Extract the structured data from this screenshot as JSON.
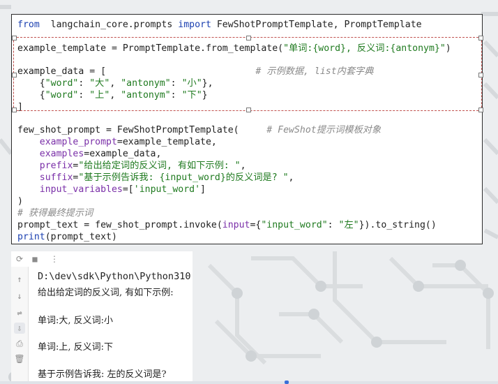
{
  "editor": {
    "lines": [
      {
        "parts": [
          [
            "kw",
            "from"
          ],
          [
            "",
            "  langchain_core.prompts "
          ],
          [
            "kw",
            "import"
          ],
          [
            "",
            " FewShotPromptTemplate, PromptTemplate"
          ]
        ]
      },
      {
        "parts": [
          [
            "",
            "example_template = PromptTemplate.from_template("
          ],
          [
            "str",
            "\"单词:{word}, 反义词:{antonym}\""
          ],
          [
            "",
            ")"
          ]
        ]
      },
      {
        "parts": [
          [
            "",
            "example_data = [                           "
          ],
          [
            "cm",
            "# 示例数据, list内套字典"
          ]
        ]
      },
      {
        "parts": [
          [
            "",
            "    {"
          ],
          [
            "str",
            "\"word\""
          ],
          [
            "",
            ": "
          ],
          [
            "str",
            "\"大\""
          ],
          [
            "",
            ", "
          ],
          [
            "str",
            "\"antonym\""
          ],
          [
            "",
            ": "
          ],
          [
            "str",
            "\"小\""
          ],
          [
            "",
            "},"
          ]
        ]
      },
      {
        "parts": [
          [
            "",
            "    {"
          ],
          [
            "str",
            "\"word\""
          ],
          [
            "",
            ": "
          ],
          [
            "str",
            "\"上\""
          ],
          [
            "",
            ", "
          ],
          [
            "str",
            "\"antonym\""
          ],
          [
            "",
            ": "
          ],
          [
            "str",
            "\"下\""
          ],
          [
            "",
            "}"
          ]
        ]
      },
      {
        "parts": [
          [
            "",
            "]"
          ]
        ]
      },
      {
        "parts": [
          [
            "",
            "few_shot_prompt = FewShotPromptTemplate(     "
          ],
          [
            "cm",
            "# FewShot提示词模板对象"
          ]
        ]
      },
      {
        "parts": [
          [
            "arg",
            "    example_prompt"
          ],
          [
            "",
            "=example_template,"
          ]
        ]
      },
      {
        "parts": [
          [
            "arg",
            "    examples"
          ],
          [
            "",
            "=example_data,"
          ]
        ]
      },
      {
        "parts": [
          [
            "arg",
            "    prefix"
          ],
          [
            "",
            "="
          ],
          [
            "str",
            "\"给出给定词的反义词, 有如下示例: \""
          ],
          [
            "",
            ","
          ]
        ]
      },
      {
        "parts": [
          [
            "arg",
            "    suffix"
          ],
          [
            "",
            "="
          ],
          [
            "str",
            "\"基于示例告诉我: {input_word}的反义词是? \""
          ],
          [
            "",
            ","
          ]
        ]
      },
      {
        "parts": [
          [
            "arg",
            "    input_variables"
          ],
          [
            "",
            "=["
          ],
          [
            "str",
            "'input_word'"
          ],
          [
            "",
            "]"
          ]
        ]
      },
      {
        "parts": [
          [
            "",
            ")"
          ]
        ]
      },
      {
        "parts": [
          [
            "cm",
            "# 获得最终提示词"
          ]
        ]
      },
      {
        "parts": [
          [
            "",
            "prompt_text = few_shot_prompt.invoke("
          ],
          [
            "arg",
            "input"
          ],
          [
            "",
            "={"
          ],
          [
            "str",
            "\"input_word\""
          ],
          [
            "",
            ": "
          ],
          [
            "str",
            "\"左\""
          ],
          [
            "",
            "}).to_string()"
          ]
        ]
      },
      {
        "parts": [
          [
            "kw",
            "print"
          ],
          [
            "",
            "(prompt_text)"
          ]
        ]
      }
    ]
  },
  "run_panel": {
    "toolbar_icons": [
      "rerun-icon",
      "stop-icon",
      "more-icon"
    ],
    "toolbar_glyphs": [
      "⟳",
      "■",
      "⋮"
    ],
    "gutter_icons": [
      "up-arrow-icon",
      "down-arrow-icon",
      "soft-wrap-icon",
      "scroll-to-end-icon",
      "print-icon",
      "trash-icon"
    ],
    "gutter_glyphs": [
      "↑",
      "↓",
      "⇌",
      "⇩",
      "⎙",
      "🗑"
    ],
    "output": {
      "path": "D:\\dev\\sdk\\Python\\Python310",
      "prefix": "给出给定词的反义词, 有如下示例:",
      "example1": "单词:大, 反义词:小",
      "example2": "单词:上, 反义词:下",
      "question": "基于示例告诉我: 左的反义词是?"
    }
  }
}
